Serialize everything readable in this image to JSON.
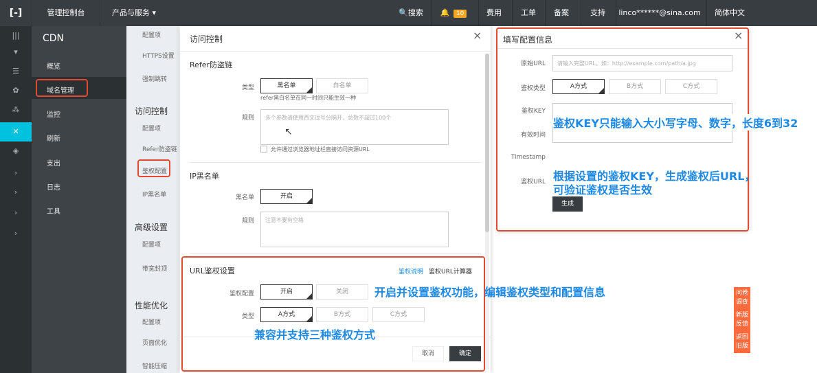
{
  "topbar": {
    "console": "管理控制台",
    "products": "产品与服务 ▾",
    "search": "搜索",
    "badge": "10",
    "fees": "费用",
    "tickets": "工单",
    "record": "备案",
    "support": "支持",
    "account": "linco******@sina.com",
    "lang": "简体中文"
  },
  "nav": {
    "title": "CDN",
    "items": [
      "概览",
      "域名管理",
      "监控",
      "刷新",
      "支出",
      "日志",
      "工具"
    ]
  },
  "subnav": {
    "items1": [
      "配置项",
      "HTTPS设置",
      "强制跳转"
    ],
    "sec_access": "访问控制",
    "items2": [
      "配置项",
      "Refer防盗链",
      "鉴权配置",
      "IP黑名单"
    ],
    "sec_adv": "高级设置",
    "items3": [
      "配置项",
      "带宽封顶"
    ],
    "sec_perf": "性能优化",
    "items4": [
      "配置项",
      "页面优化",
      "智能压缩"
    ]
  },
  "access": {
    "title": "访问控制",
    "refer": {
      "title": "Refer防盗链",
      "type_label": "类型",
      "black": "黑名单",
      "white": "白名单",
      "hint": "refer黑白名单在同一时间只能生效一种",
      "rule_label": "规则",
      "rule_placeholder": "多个参数请使用西文逗号分隔开，总数不超过100个",
      "checkbox": "允许通过浏览器地址栏直接访问资源URL"
    },
    "ip": {
      "title": "IP黑名单",
      "label": "黑名单",
      "toggle": "开启",
      "rule_label": "规则",
      "rule_placeholder": "注意不要有空格"
    },
    "url_auth": {
      "title": "URL鉴权设置",
      "link1": "鉴权说明",
      "link2": "鉴权URL计算器",
      "cfg_label": "鉴权配置",
      "on": "开启",
      "off": "关闭",
      "type_label": "类型",
      "types": [
        "A方式",
        "B方式",
        "C方式"
      ]
    },
    "cancel": "取消",
    "ok": "确定"
  },
  "fill": {
    "title": "填写配置信息",
    "orig_label": "原始URL",
    "orig_placeholder": "请输入完整URL，如：http://example.com/path/a.jpg",
    "type_label": "鉴权类型",
    "types": [
      "A方式",
      "B方式",
      "C方式"
    ],
    "key_label": "鉴权KEY",
    "valid_label": "有效时间",
    "ts_label": "Timestamp",
    "url_label": "鉴权URL",
    "generate": "生成"
  },
  "annotations": {
    "a1": "鉴权KEY只能输入大小写字母、数字，长度6到32",
    "a2_line1": "根据设置的鉴权KEY，生成鉴权后URL，",
    "a2_line2": "可验证鉴权是否生效",
    "a3": "开启并设置鉴权功能，编辑鉴权类型和配置信息",
    "a4": "兼容并支持三种鉴权方式"
  },
  "sidetabs": {
    "t1": "问卷\n调查",
    "t2": "新版\n反馈",
    "t3": "返回\n旧版"
  },
  "colors": {
    "topbar": "#373d41",
    "accent": "#00c1de",
    "highlight": "#e24a31",
    "annotation": "#1e88e5",
    "sidetab": "#ff6a3d"
  }
}
